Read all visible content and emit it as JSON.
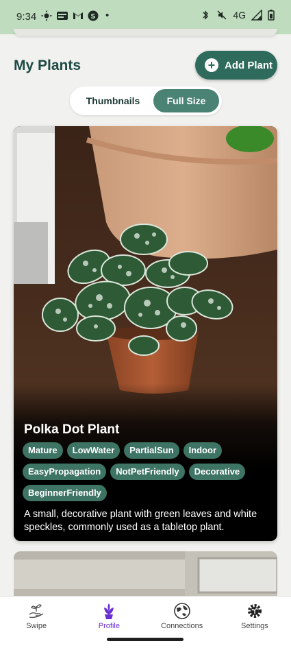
{
  "status_bar": {
    "time": "9:34",
    "network": "4G",
    "dot": "•",
    "left_icons": [
      "brightness-icon",
      "news-icon",
      "gmail-icon",
      "shazam-icon"
    ],
    "right_icons": [
      "bluetooth-icon",
      "mute-icon",
      "signal-icon",
      "battery-icon"
    ]
  },
  "header": {
    "title": "My Plants",
    "add_button_label": "Add Plant"
  },
  "view_toggle": {
    "options": [
      "Thumbnails",
      "Full Size"
    ],
    "selected": "Full Size"
  },
  "plant_card": {
    "name": "Polka Dot Plant",
    "tags": [
      "Mature",
      "LowWater",
      "PartialSun",
      "Indoor",
      "EasyPropagation",
      "NotPetFriendly",
      "Decorative",
      "BeginnerFriendly"
    ],
    "description": "A small, decorative plant with green leaves and white speckles, commonly used as a tabletop plant."
  },
  "bottom_nav": {
    "items": [
      {
        "label": "Swipe",
        "icon": "hand-plant-icon"
      },
      {
        "label": "Profile",
        "icon": "plant-profile-icon"
      },
      {
        "label": "Connections",
        "icon": "globe-icon"
      },
      {
        "label": "Settings",
        "icon": "gear-plant-icon"
      }
    ],
    "active": "Profile"
  },
  "colors": {
    "status_bar": "#bfdcbf",
    "accent": "#2e6b5c",
    "tag": "#3e7464",
    "title": "#1e4a44",
    "nav_active": "#6a2fd0"
  }
}
